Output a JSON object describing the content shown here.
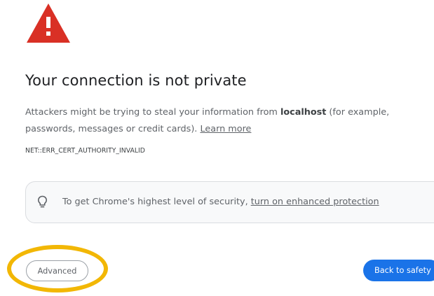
{
  "warning": {
    "icon": "warning-triangle-icon",
    "color": "#d93025"
  },
  "title": "Your connection is not private",
  "description": {
    "before_host": "Attackers might be trying to steal your information from ",
    "host": "localhost",
    "after_host": " (for example, passwords, messages or credit cards). ",
    "learn_more": "Learn more"
  },
  "error_code": "NET::ERR_CERT_AUTHORITY_INVALID",
  "protection": {
    "icon": "lightbulb-icon",
    "text": "To get Chrome's highest level of security, ",
    "link": "turn on enhanced protection"
  },
  "buttons": {
    "advanced": "Advanced",
    "back_to_safety": "Back to safety"
  },
  "colors": {
    "primary_button": "#1a73e8",
    "highlight": "#f2b705"
  }
}
